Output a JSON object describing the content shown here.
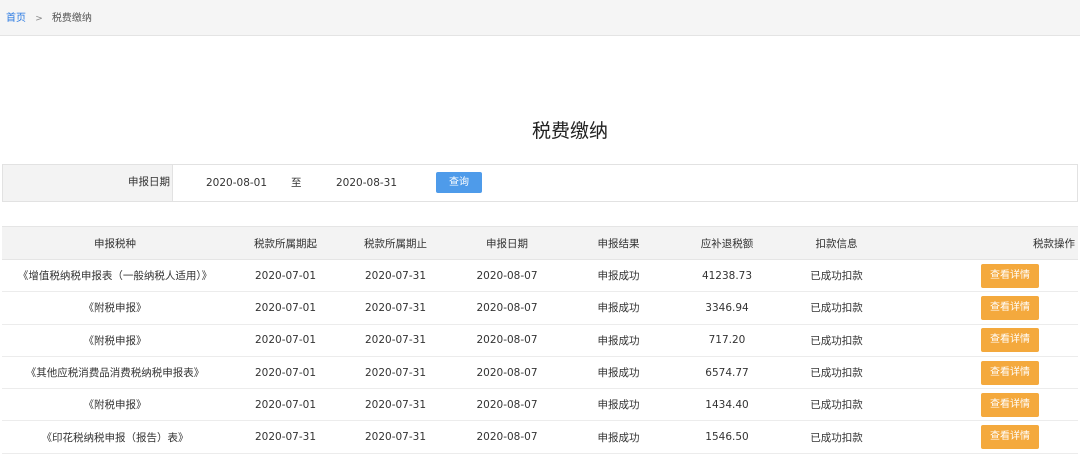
{
  "breadcrumb": {
    "home": "首页",
    "separator": ">",
    "current": "税费缴纳"
  },
  "page_title": "税费缴纳",
  "filter": {
    "label": "申报日期",
    "start_date": "2020-08-01",
    "separator": "至",
    "end_date": "2020-08-31",
    "query_button": "查询"
  },
  "table": {
    "headers": [
      "申报税种",
      "税款所属期起",
      "税款所属期止",
      "申报日期",
      "申报结果",
      "应补退税额",
      "扣款信息",
      "税款操作"
    ],
    "rows": [
      {
        "tax_type": "《增值税纳税申报表（一般纳税人适用）》",
        "period_start": "2020-07-01",
        "period_end": "2020-07-31",
        "declare_date": "2020-08-07",
        "result": "申报成功",
        "amount": "41238.73",
        "deduction": "已成功扣款",
        "action": "查看详情"
      },
      {
        "tax_type": "《附税申报》",
        "period_start": "2020-07-01",
        "period_end": "2020-07-31",
        "declare_date": "2020-08-07",
        "result": "申报成功",
        "amount": "3346.94",
        "deduction": "已成功扣款",
        "action": "查看详情"
      },
      {
        "tax_type": "《附税申报》",
        "period_start": "2020-07-01",
        "period_end": "2020-07-31",
        "declare_date": "2020-08-07",
        "result": "申报成功",
        "amount": "717.20",
        "deduction": "已成功扣款",
        "action": "查看详情"
      },
      {
        "tax_type": "《其他应税消费品消费税纳税申报表》",
        "period_start": "2020-07-01",
        "period_end": "2020-07-31",
        "declare_date": "2020-08-07",
        "result": "申报成功",
        "amount": "6574.77",
        "deduction": "已成功扣款",
        "action": "查看详情"
      },
      {
        "tax_type": "《附税申报》",
        "period_start": "2020-07-01",
        "period_end": "2020-07-31",
        "declare_date": "2020-08-07",
        "result": "申报成功",
        "amount": "1434.40",
        "deduction": "已成功扣款",
        "action": "查看详情"
      },
      {
        "tax_type": "《印花税纳税申报（报告）表》",
        "period_start": "2020-07-31",
        "period_end": "2020-07-31",
        "declare_date": "2020-08-07",
        "result": "申报成功",
        "amount": "1546.50",
        "deduction": "已成功扣款",
        "action": "查看详情"
      }
    ]
  },
  "colors": {
    "link": "#2a7ae2",
    "query_button": "#4e9bea",
    "detail_button": "#f4a93d",
    "header_bg": "#f3f3f3"
  }
}
